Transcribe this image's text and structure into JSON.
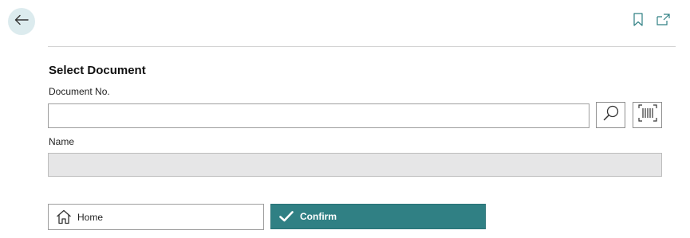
{
  "header": {
    "back_icon": "arrow-left-icon",
    "bookmark_icon": "bookmark-icon",
    "popout_icon": "open-in-new-window-icon"
  },
  "form": {
    "section_title": "Select Document",
    "document_no": {
      "label": "Document No.",
      "value": "",
      "placeholder": ""
    },
    "name": {
      "label": "Name",
      "value": ""
    },
    "lookup_icon": "search-icon",
    "scan_icon": "barcode-scan-icon"
  },
  "actions": {
    "home_label": "Home",
    "home_icon": "home-icon",
    "confirm_label": "Confirm",
    "confirm_icon": "checkmark-icon"
  },
  "colors": {
    "accent": "#308084",
    "back_button_bg": "#dcebee",
    "disabled_field_bg": "#e6e6e7"
  }
}
